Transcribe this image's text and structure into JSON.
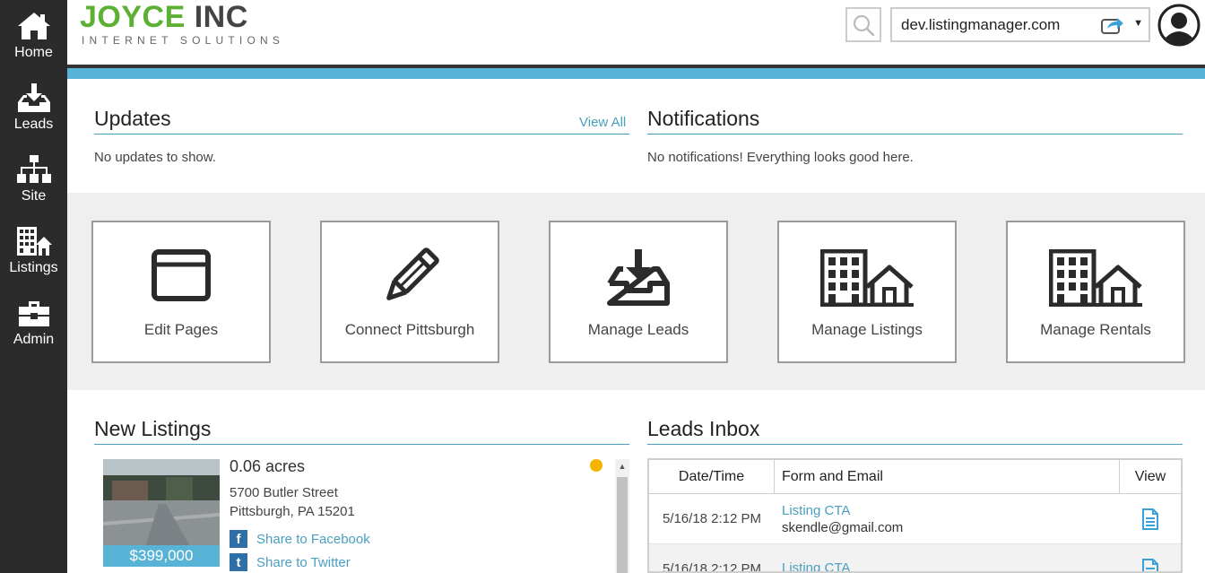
{
  "sidebar": {
    "items": [
      {
        "label": "Home",
        "icon": "home-icon"
      },
      {
        "label": "Leads",
        "icon": "inbox-download-icon"
      },
      {
        "label": "Site",
        "icon": "sitemap-icon"
      },
      {
        "label": "Listings",
        "icon": "buildings-icon"
      },
      {
        "label": "Admin",
        "icon": "toolbox-icon"
      }
    ]
  },
  "header": {
    "logo_main_a": "JOYCE",
    "logo_main_b": " INC",
    "logo_sub": "INTERNET SOLUTIONS",
    "site_domain": "dev.listingmanager.com",
    "caret": "▼"
  },
  "updates": {
    "title": "Updates",
    "view_all": "View All",
    "empty": "No updates to show."
  },
  "notifications": {
    "title": "Notifications",
    "empty": "No notifications! Everything looks good here."
  },
  "tiles": [
    {
      "label": "Edit Pages",
      "icon": "browser-window-icon"
    },
    {
      "label": "Connect Pittsburgh",
      "icon": "pencil-icon"
    },
    {
      "label": "Manage Leads",
      "icon": "inbox-download-icon"
    },
    {
      "label": "Manage Listings",
      "icon": "buildings-icon"
    },
    {
      "label": "Manage Rentals",
      "icon": "buildings-icon"
    }
  ],
  "new_listings": {
    "title": "New Listings",
    "items": [
      {
        "price": "$399,000",
        "size": "0.06 acres",
        "address1": "5700 Butler Street",
        "address2": "Pittsburgh, PA 15201",
        "share_facebook": "Share to Facebook",
        "share_twitter": "Share to Twitter",
        "status_color": "#f4b400"
      }
    ]
  },
  "leads_inbox": {
    "title": "Leads Inbox",
    "columns": [
      "Date/Time",
      "Form and Email",
      "View"
    ],
    "rows": [
      {
        "date": "5/16/18 2:12 PM",
        "form": "Listing CTA",
        "email": "skendle@gmail.com"
      },
      {
        "date": "5/16/18 2:12 PM",
        "form": "Listing CTA",
        "email": ""
      }
    ]
  },
  "colors": {
    "accent": "#58b3d6",
    "link": "#4a9fbf",
    "brand_green": "#5db033",
    "sidebar": "#2b2b2b"
  }
}
